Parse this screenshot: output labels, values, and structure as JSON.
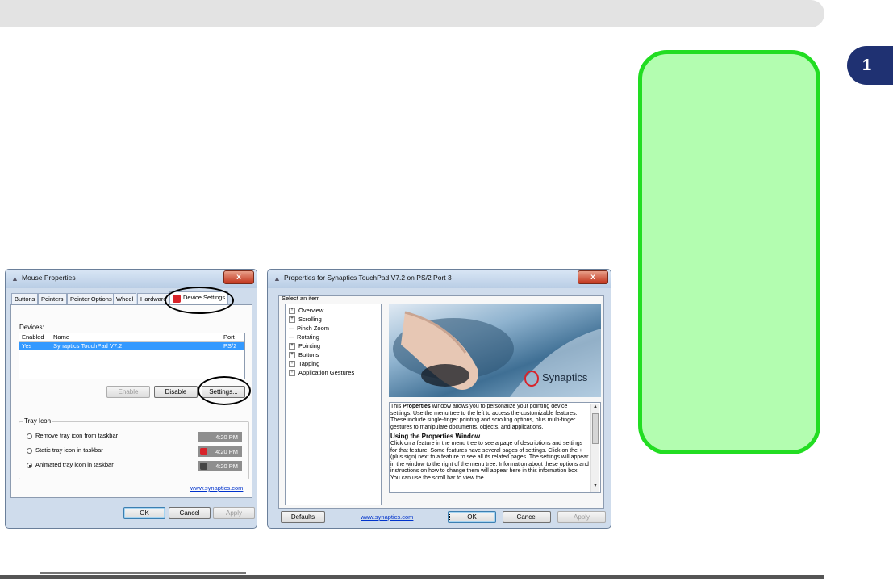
{
  "chapter": {
    "number": "1"
  },
  "mouse_dialog": {
    "title": "Mouse Properties",
    "close": "x",
    "tabs": [
      "Buttons",
      "Pointers",
      "Pointer Options",
      "Wheel",
      "Hardware",
      "Device Settings"
    ],
    "devices_label": "Devices:",
    "columns": [
      "Enabled",
      "Name",
      "Port"
    ],
    "rows": [
      {
        "enabled": "Yes",
        "name": "Synaptics TouchPad V7.2",
        "port": "PS/2"
      }
    ],
    "enable_btn": "Enable",
    "disable_btn": "Disable",
    "settings_btn": "Settings...",
    "tray_group": "Tray Icon",
    "tray_options": [
      {
        "label": "Remove tray icon from taskbar",
        "time": "4:20 PM",
        "selected": false
      },
      {
        "label": "Static tray icon in taskbar",
        "time": "4:20 PM",
        "selected": false
      },
      {
        "label": "Animated tray icon in taskbar",
        "time": "4:20 PM",
        "selected": true
      }
    ],
    "link": "www.synaptics.com",
    "ok": "OK",
    "cancel": "Cancel",
    "apply": "Apply"
  },
  "synaptics_dialog": {
    "title": "Properties for Synaptics TouchPad V7.2 on PS/2 Port 3",
    "close": "x",
    "select_label": "Select an item",
    "tree": [
      {
        "label": "Overview",
        "expandable": true
      },
      {
        "label": "Scrolling",
        "expandable": true
      },
      {
        "label": "Pinch Zoom",
        "expandable": false
      },
      {
        "label": "Rotating",
        "expandable": false
      },
      {
        "label": "Pointing",
        "expandable": true
      },
      {
        "label": "Buttons",
        "expandable": true
      },
      {
        "label": "Tapping",
        "expandable": true
      },
      {
        "label": "Application Gestures",
        "expandable": true
      }
    ],
    "brand": "Synaptics",
    "info_p1_pre": "This ",
    "info_p1_bold": "Properties",
    "info_p1_post": " window allows you to personalize your pointing device settings.  Use the menu tree to the left to access the customizable features.  These include single-finger pointing and scrolling options, plus multi-finger gestures to manipulate documents, objects, and applications.",
    "info_heading": "Using the Properties Window",
    "info_p2": "Click on a feature in the menu tree to see a page of descriptions and settings for that feature.  Some features have several pages of settings. Click on the + (plus sign) next to a feature to see all its related pages.  The settings will appear in the window to the right of the menu tree.  Information about these options and instructions on how to change them will appear here in this information box.  You can use the scroll bar to view the",
    "defaults_btn": "Defaults",
    "link": "www.synaptics.com",
    "ok": "OK",
    "cancel": "Cancel",
    "apply": "Apply"
  },
  "colors": {
    "callout_fill": "#b3fdb0",
    "callout_border": "#22dd22",
    "chapter_tab": "#1f3172",
    "selection": "#3399ff"
  }
}
